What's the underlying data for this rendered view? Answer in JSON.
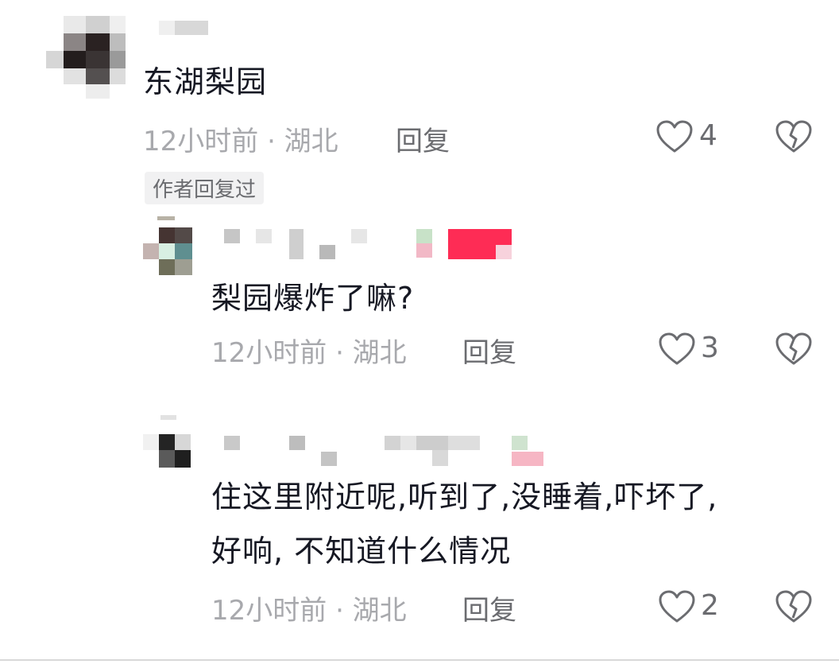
{
  "comments": [
    {
      "text": "东湖梨园",
      "time_location": "12小时前 · 湖北",
      "reply_label": "回复",
      "likes": "4",
      "author_replied_tag": "作者回复过"
    },
    {
      "text": "梨园爆炸了嘛?",
      "time_location": "12小时前 · 湖北",
      "reply_label": "回复",
      "likes": "3"
    },
    {
      "text_line1": "住这里附近呢,听到了,没睡着,吓坏了,",
      "text_line2": "好响, 不知道什么情况",
      "time_location": "12小时前 · 湖北",
      "reply_label": "回复",
      "likes": "2"
    }
  ],
  "icons": {
    "like": "heart-outline-icon",
    "dislike": "broken-heart-icon"
  },
  "colors": {
    "text": "#161823",
    "meta": "#a8a9ad",
    "icon": "#6b6c70",
    "badge_red": "#fe2c55"
  }
}
